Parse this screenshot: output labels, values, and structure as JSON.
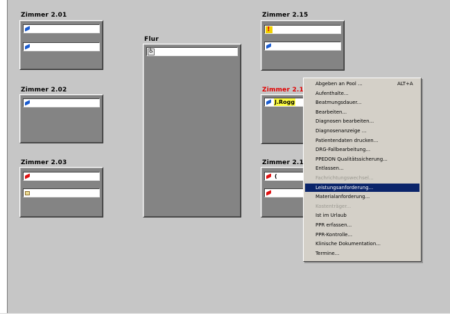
{
  "rooms": {
    "r201": {
      "title": "Zimmer 2.01",
      "beds": [
        {
          "icon": "blue-patient-icon",
          "name": ""
        },
        {
          "icon": "blue-patient-icon",
          "name": ""
        }
      ]
    },
    "r202": {
      "title": "Zimmer 2.02",
      "beds": [
        {
          "icon": "blue-patient-icon",
          "name": ""
        }
      ]
    },
    "r203": {
      "title": "Zimmer 2.03",
      "beds": [
        {
          "icon": "red-patient-icon",
          "name": ""
        },
        {
          "icon": "stroller-icon",
          "name": ""
        }
      ]
    },
    "flur": {
      "title": "Flur",
      "beds": [
        {
          "icon": "wheelchair-icon",
          "name": ""
        }
      ]
    },
    "r215": {
      "title": "Zimmer 2.15",
      "beds": [
        {
          "icon": "alert-icon",
          "name": ""
        },
        {
          "icon": "blue-patient-icon",
          "name": ""
        }
      ]
    },
    "r21x": {
      "title": "Zimmer 2.1",
      "beds": [
        {
          "icon": "blue-patient-icon",
          "name": "J.Rogg"
        }
      ]
    },
    "r21y": {
      "title": "Zimmer 2.1",
      "beds": [
        {
          "icon": "red-patient-icon",
          "name": "("
        },
        {
          "icon": "red-patient-icon",
          "name": ""
        }
      ]
    }
  },
  "context_menu": {
    "items": [
      {
        "label": "Abgeben an Pool ...",
        "shortcut": "ALT+A",
        "state": "normal"
      },
      {
        "label": "Aufenthalte...",
        "shortcut": "",
        "state": "normal"
      },
      {
        "label": "Beatmungsdauer...",
        "shortcut": "",
        "state": "normal"
      },
      {
        "label": "Bearbeiten...",
        "shortcut": "",
        "state": "normal"
      },
      {
        "label": "Diagnosen bearbeiten...",
        "shortcut": "",
        "state": "normal"
      },
      {
        "label": "Diagnosenanzeige ...",
        "shortcut": "",
        "state": "normal"
      },
      {
        "label": "Patientendaten drucken...",
        "shortcut": "",
        "state": "normal"
      },
      {
        "label": "DRG-Fallbearbeitung...",
        "shortcut": "",
        "state": "normal"
      },
      {
        "label": "PPEDON Qualitätssicherung...",
        "shortcut": "",
        "state": "normal"
      },
      {
        "label": "Entlassen...",
        "shortcut": "",
        "state": "normal"
      },
      {
        "label": "Fachrichtungswechsel...",
        "shortcut": "",
        "state": "disabled"
      },
      {
        "label": "Leistungsanforderung...",
        "shortcut": "",
        "state": "selected"
      },
      {
        "label": "Materialanforderung...",
        "shortcut": "",
        "state": "normal"
      },
      {
        "label": "Kostenträger...",
        "shortcut": "",
        "state": "disabled"
      },
      {
        "label": "Ist im Urlaub",
        "shortcut": "",
        "state": "normal"
      },
      {
        "label": "PPR erfassen...",
        "shortcut": "",
        "state": "normal"
      },
      {
        "label": "PPR-Kontrolle...",
        "shortcut": "",
        "state": "normal"
      },
      {
        "label": "Klinische Dokumentation...",
        "shortcut": "",
        "state": "normal"
      },
      {
        "label": "Termine...",
        "shortcut": "",
        "state": "normal"
      }
    ]
  },
  "colors": {
    "background": "#c6c6c6",
    "room_box": "#848484",
    "alert_title": "#e00000",
    "menu_bg": "#d4d0c8",
    "menu_selected": "#0a246a",
    "name_highlight": "#ffff40"
  }
}
